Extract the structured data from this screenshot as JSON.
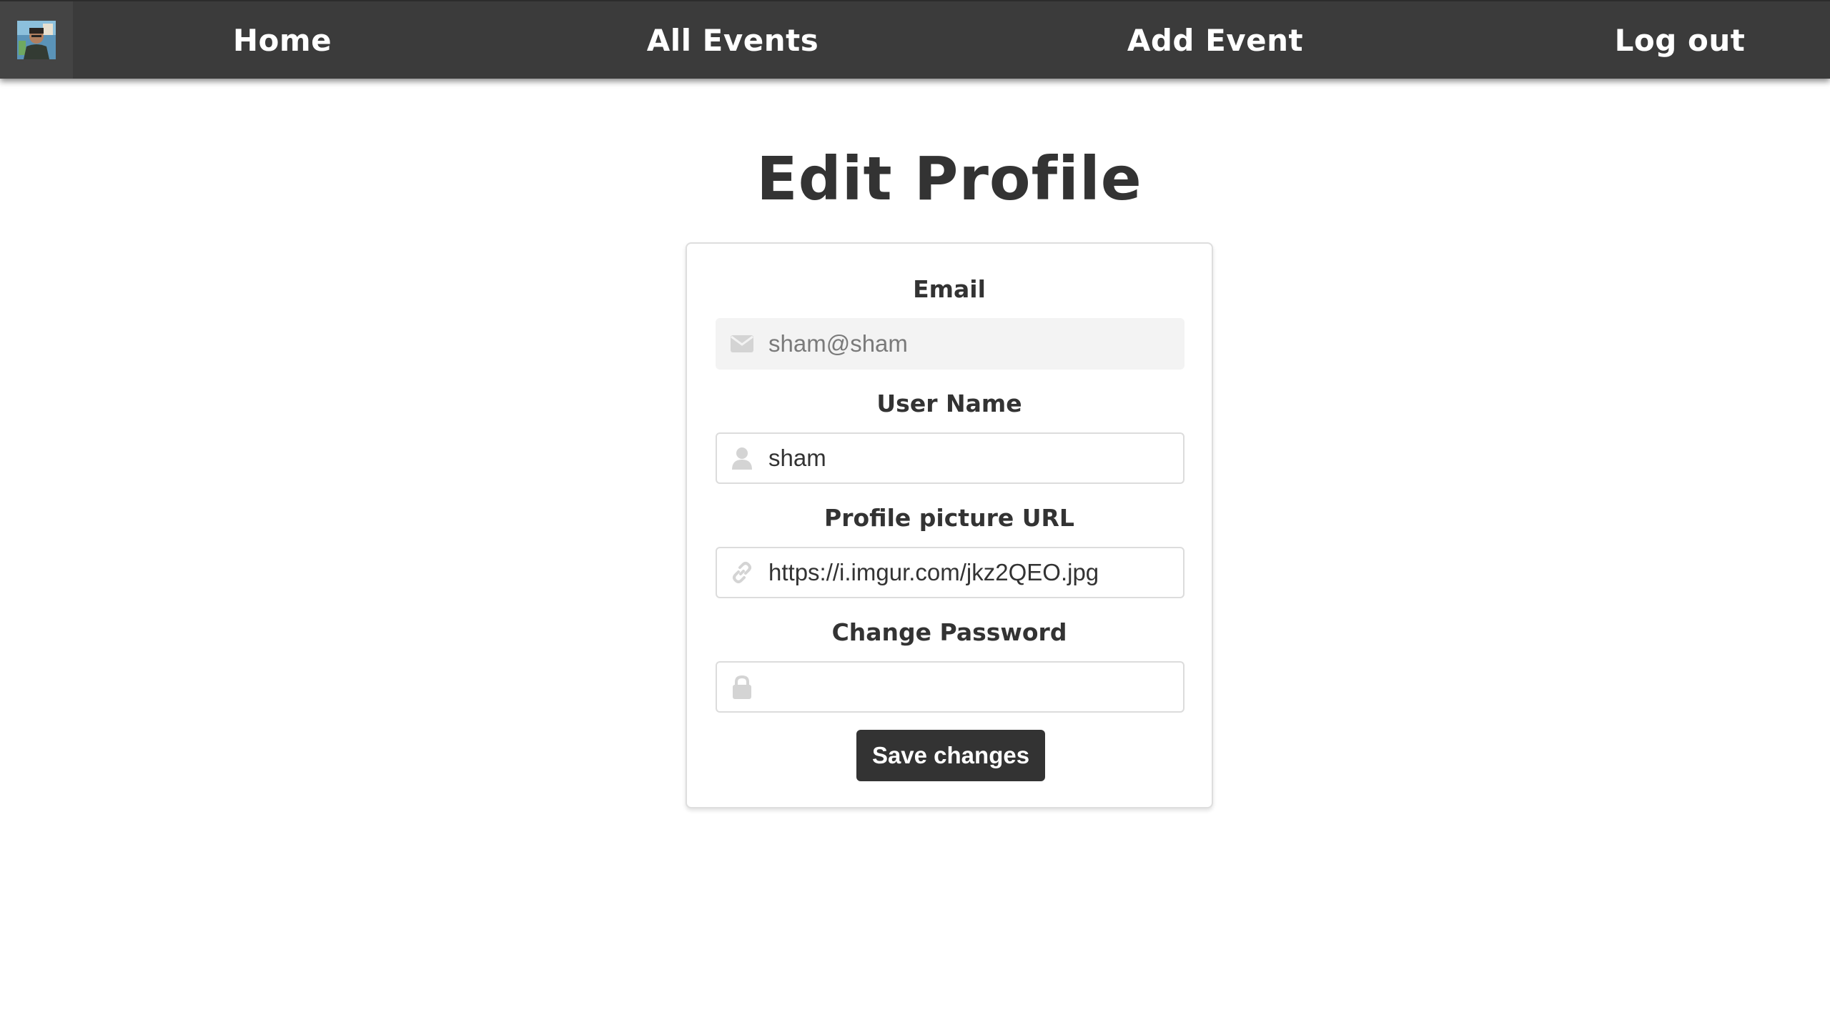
{
  "nav": {
    "avatar": "user-avatar",
    "links": {
      "home": "Home",
      "all_events": "All Events",
      "add_event": "Add Event",
      "logout": "Log out"
    }
  },
  "page": {
    "title": "Edit Profile"
  },
  "form": {
    "email": {
      "label": "Email",
      "value": "sham@sham",
      "icon": "envelope-icon",
      "disabled": true
    },
    "username": {
      "label": "User Name",
      "value": "sham",
      "icon": "user-icon"
    },
    "picture_url": {
      "label": "Profile picture URL",
      "value": "https://i.imgur.com/jkz2QEO.jpg",
      "icon": "link-icon"
    },
    "password": {
      "label": "Change Password",
      "value": "",
      "icon": "lock-icon"
    },
    "save_label": "Save changes"
  },
  "colors": {
    "navbar": "#3b3b3b",
    "text": "#333333",
    "button": "#333333",
    "icon": "#d4d4d4"
  }
}
